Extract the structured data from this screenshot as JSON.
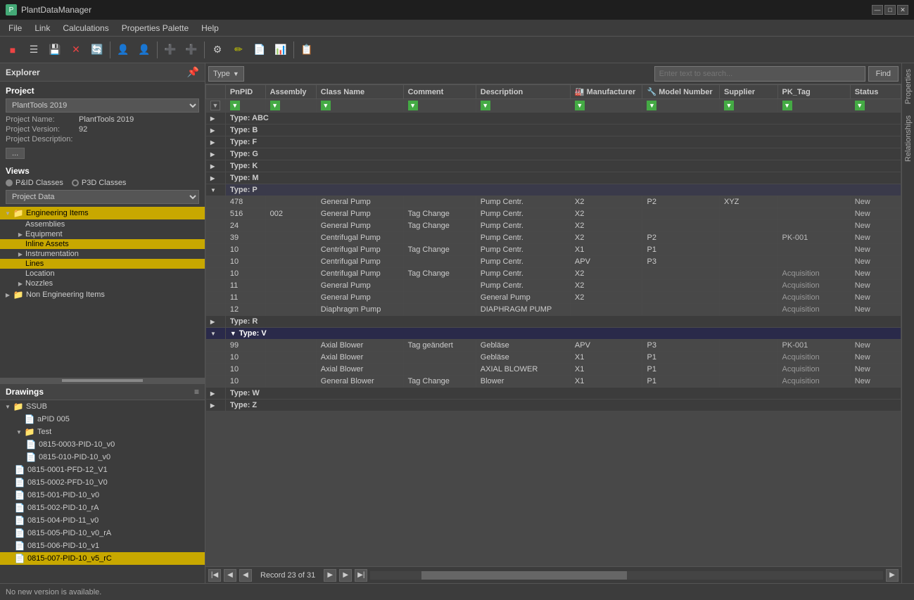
{
  "titlebar": {
    "icon": "P",
    "title": "PlantDataManager",
    "controls": [
      "—",
      "□",
      "✕"
    ]
  },
  "menubar": {
    "items": [
      "File",
      "Link",
      "Calculations",
      "Properties Palette",
      "Help"
    ]
  },
  "toolbar": {
    "buttons": [
      "🔴",
      "☰",
      "💾",
      "✕",
      "🔄",
      "👤",
      "👤",
      "➕",
      "➕",
      "⚙",
      "✏",
      "📄",
      "📊",
      "📋"
    ]
  },
  "explorer": {
    "title": "Explorer",
    "project_section": "Project",
    "project_name": "PlantTools 2019",
    "project_name_label": "Project Name:",
    "project_name_value": "PlantTools 2019",
    "project_version_label": "Project Version:",
    "project_version_value": "92",
    "project_desc_label": "Project Description:",
    "ellipsis_label": "...",
    "views_title": "Views",
    "radio_pid": "P&ID Classes",
    "radio_p3d": "P3D Classes",
    "dropdown_label": "Project Data",
    "tree": {
      "items": [
        {
          "id": "engineering-items",
          "label": "Engineering Items",
          "indent": 0,
          "expanded": true,
          "selected": false,
          "icon": "folder",
          "hasArrow": true
        },
        {
          "id": "assemblies",
          "label": "Assemblies",
          "indent": 1,
          "expanded": false,
          "selected": false,
          "icon": "item",
          "hasArrow": false
        },
        {
          "id": "equipment",
          "label": "Equipment",
          "indent": 1,
          "expanded": false,
          "selected": false,
          "icon": "item",
          "hasArrow": true
        },
        {
          "id": "inline-assets",
          "label": "Inline Assets",
          "indent": 1,
          "expanded": false,
          "selected": true,
          "icon": "item",
          "hasArrow": false
        },
        {
          "id": "instrumentation",
          "label": "Instrumentation",
          "indent": 1,
          "expanded": false,
          "selected": false,
          "icon": "item",
          "hasArrow": true
        },
        {
          "id": "lines",
          "label": "Lines",
          "indent": 1,
          "expanded": false,
          "selected": true,
          "icon": "item",
          "hasArrow": false
        },
        {
          "id": "location",
          "label": "Location",
          "indent": 1,
          "expanded": false,
          "selected": false,
          "icon": "item",
          "hasArrow": false
        },
        {
          "id": "nozzles",
          "label": "Nozzles",
          "indent": 1,
          "expanded": false,
          "selected": false,
          "icon": "item",
          "hasArrow": true
        },
        {
          "id": "non-engineering-items",
          "label": "Non Engineering Items",
          "indent": 0,
          "expanded": false,
          "selected": false,
          "icon": "folder",
          "hasArrow": true
        }
      ]
    }
  },
  "drawings": {
    "title": "Drawings",
    "tree": [
      {
        "id": "ssub",
        "label": "SSUB",
        "indent": 0,
        "expanded": true,
        "icon": "folder"
      },
      {
        "id": "apid005",
        "label": "aPID 005",
        "indent": 1,
        "expanded": false,
        "icon": "doc"
      },
      {
        "id": "test",
        "label": "Test",
        "indent": 1,
        "expanded": true,
        "icon": "folder"
      },
      {
        "id": "d1",
        "label": "0815-0003-PID-10_v0",
        "indent": 2,
        "expanded": false,
        "icon": "doc"
      },
      {
        "id": "d2",
        "label": "0815-010-PID-10_v0",
        "indent": 2,
        "expanded": false,
        "icon": "doc"
      },
      {
        "id": "d3",
        "label": "0815-0001-PFD-12_V1",
        "indent": 1,
        "expanded": false,
        "icon": "doc"
      },
      {
        "id": "d4",
        "label": "0815-0002-PFD-10_V0",
        "indent": 1,
        "expanded": false,
        "icon": "doc"
      },
      {
        "id": "d5",
        "label": "0815-001-PID-10_v0",
        "indent": 1,
        "expanded": false,
        "icon": "doc"
      },
      {
        "id": "d6",
        "label": "0815-002-PID-10_rA",
        "indent": 1,
        "expanded": false,
        "icon": "doc"
      },
      {
        "id": "d7",
        "label": "0815-004-PID-11_v0",
        "indent": 1,
        "expanded": false,
        "icon": "doc"
      },
      {
        "id": "d8",
        "label": "0815-005-PID-10_v0_rA",
        "indent": 1,
        "expanded": false,
        "icon": "doc"
      },
      {
        "id": "d9",
        "label": "0815-006-PID-10_v1",
        "indent": 1,
        "expanded": false,
        "icon": "doc"
      },
      {
        "id": "d10",
        "label": "0815-007-PID-10_v5_rC",
        "indent": 1,
        "expanded": false,
        "icon": "doc",
        "selected": true
      }
    ]
  },
  "grid": {
    "type_dropdown": "Type",
    "search_placeholder": "Enter text to search...",
    "find_label": "Find",
    "columns": [
      "PnPID",
      "Assembly",
      "Class Name",
      "Comment",
      "Description",
      "🏭 Manufacturer",
      "🔧 Model Number",
      "Supplier",
      "PK_Tag",
      "Status"
    ],
    "groups": [
      {
        "id": "type-abc",
        "label": "Type: ABC",
        "expanded": false,
        "rows": []
      },
      {
        "id": "type-b",
        "label": "Type: B",
        "expanded": false,
        "rows": []
      },
      {
        "id": "type-f",
        "label": "Type: F",
        "expanded": false,
        "rows": []
      },
      {
        "id": "type-g",
        "label": "Type: G",
        "expanded": false,
        "rows": []
      },
      {
        "id": "type-k",
        "label": "Type: K",
        "expanded": false,
        "rows": []
      },
      {
        "id": "type-m",
        "label": "Type: M",
        "expanded": false,
        "rows": []
      },
      {
        "id": "type-p",
        "label": "Type: P",
        "expanded": true,
        "rows": [
          {
            "pnpid": "478",
            "assembly": "",
            "classname": "General Pump",
            "comment": "",
            "description": "Pump Centr.",
            "manufacturer": "X2",
            "modelnumber": "P2",
            "supplier": "XYZ",
            "pktag": "",
            "status": "New"
          },
          {
            "pnpid": "516",
            "assembly": "002",
            "classname": "General Pump",
            "comment": "Tag Change",
            "description": "Pump Centr.",
            "manufacturer": "X2",
            "modelnumber": "",
            "supplier": "",
            "pktag": "",
            "status": "New"
          },
          {
            "pnpid": "24",
            "assembly": "",
            "classname": "General Pump",
            "comment": "Tag Change",
            "description": "Pump Centr.",
            "manufacturer": "X2",
            "modelnumber": "",
            "supplier": "",
            "pktag": "",
            "status": "New"
          },
          {
            "pnpid": "39",
            "assembly": "",
            "classname": "Centrifugal Pump",
            "comment": "",
            "description": "Pump Centr.",
            "manufacturer": "X2",
            "modelnumber": "P2",
            "supplier": "",
            "pktag": "PK-001",
            "status": "New"
          },
          {
            "pnpid": "10",
            "assembly": "",
            "classname": "Centrifugal Pump",
            "comment": "Tag Change",
            "description": "Pump Centr.",
            "manufacturer": "X1",
            "modelnumber": "P1",
            "supplier": "",
            "pktag": "",
            "status": "New"
          },
          {
            "pnpid": "10",
            "assembly": "",
            "classname": "Centrifugal Pump",
            "comment": "",
            "description": "Pump Centr.",
            "manufacturer": "APV",
            "modelnumber": "P3",
            "supplier": "",
            "pktag": "",
            "status": "New"
          },
          {
            "pnpid": "10",
            "assembly": "",
            "classname": "Centrifugal Pump",
            "comment": "Tag Change",
            "description": "Pump Centr.",
            "manufacturer": "X2",
            "modelnumber": "",
            "supplier": "",
            "pktag": "Acquisition",
            "status": "New"
          },
          {
            "pnpid": "11",
            "assembly": "",
            "classname": "General Pump",
            "comment": "",
            "description": "Pump Centr.",
            "manufacturer": "X2",
            "modelnumber": "",
            "supplier": "",
            "pktag": "Acquisition",
            "status": "New"
          },
          {
            "pnpid": "11",
            "assembly": "",
            "classname": "General Pump",
            "comment": "",
            "description": "General Pump",
            "manufacturer": "X2",
            "modelnumber": "",
            "supplier": "",
            "pktag": "Acquisition",
            "status": "New"
          },
          {
            "pnpid": "12",
            "assembly": "",
            "classname": "Diaphragm Pump",
            "comment": "",
            "description": "DIAPHRAGM PUMP",
            "manufacturer": "",
            "modelnumber": "",
            "supplier": "",
            "pktag": "Acquisition",
            "status": "New"
          }
        ]
      },
      {
        "id": "type-r",
        "label": "Type: R",
        "expanded": false,
        "rows": []
      },
      {
        "id": "type-v",
        "label": "Type: V",
        "expanded": true,
        "selected": true,
        "rows": [
          {
            "pnpid": "99",
            "assembly": "",
            "classname": "Axial Blower",
            "comment": "Tag geändert",
            "description": "Gebläse",
            "manufacturer": "APV",
            "modelnumber": "P3",
            "supplier": "",
            "pktag": "PK-001",
            "status": "New"
          },
          {
            "pnpid": "10",
            "assembly": "",
            "classname": "Axial Blower",
            "comment": "",
            "description": "Gebläse",
            "manufacturer": "X1",
            "modelnumber": "P1",
            "supplier": "",
            "pktag": "Acquisition",
            "status": "New"
          },
          {
            "pnpid": "10",
            "assembly": "",
            "classname": "Axial Blower",
            "comment": "",
            "description": "AXIAL BLOWER",
            "manufacturer": "X1",
            "modelnumber": "P1",
            "supplier": "",
            "pktag": "Acquisition",
            "status": "New"
          },
          {
            "pnpid": "10",
            "assembly": "",
            "classname": "General Blower",
            "comment": "Tag Change",
            "description": "Blower",
            "manufacturer": "X1",
            "modelnumber": "P1",
            "supplier": "",
            "pktag": "Acquisition",
            "status": "New"
          }
        ]
      },
      {
        "id": "type-w",
        "label": "Type: W",
        "expanded": false,
        "rows": []
      },
      {
        "id": "type-z",
        "label": "Type: Z",
        "expanded": false,
        "rows": []
      }
    ],
    "nav": {
      "record_text": "Record 23 of 31"
    }
  },
  "right_sidebar": {
    "tabs": [
      "Properties",
      "Relationships"
    ]
  },
  "statusbar": {
    "message": "No new version is available."
  }
}
